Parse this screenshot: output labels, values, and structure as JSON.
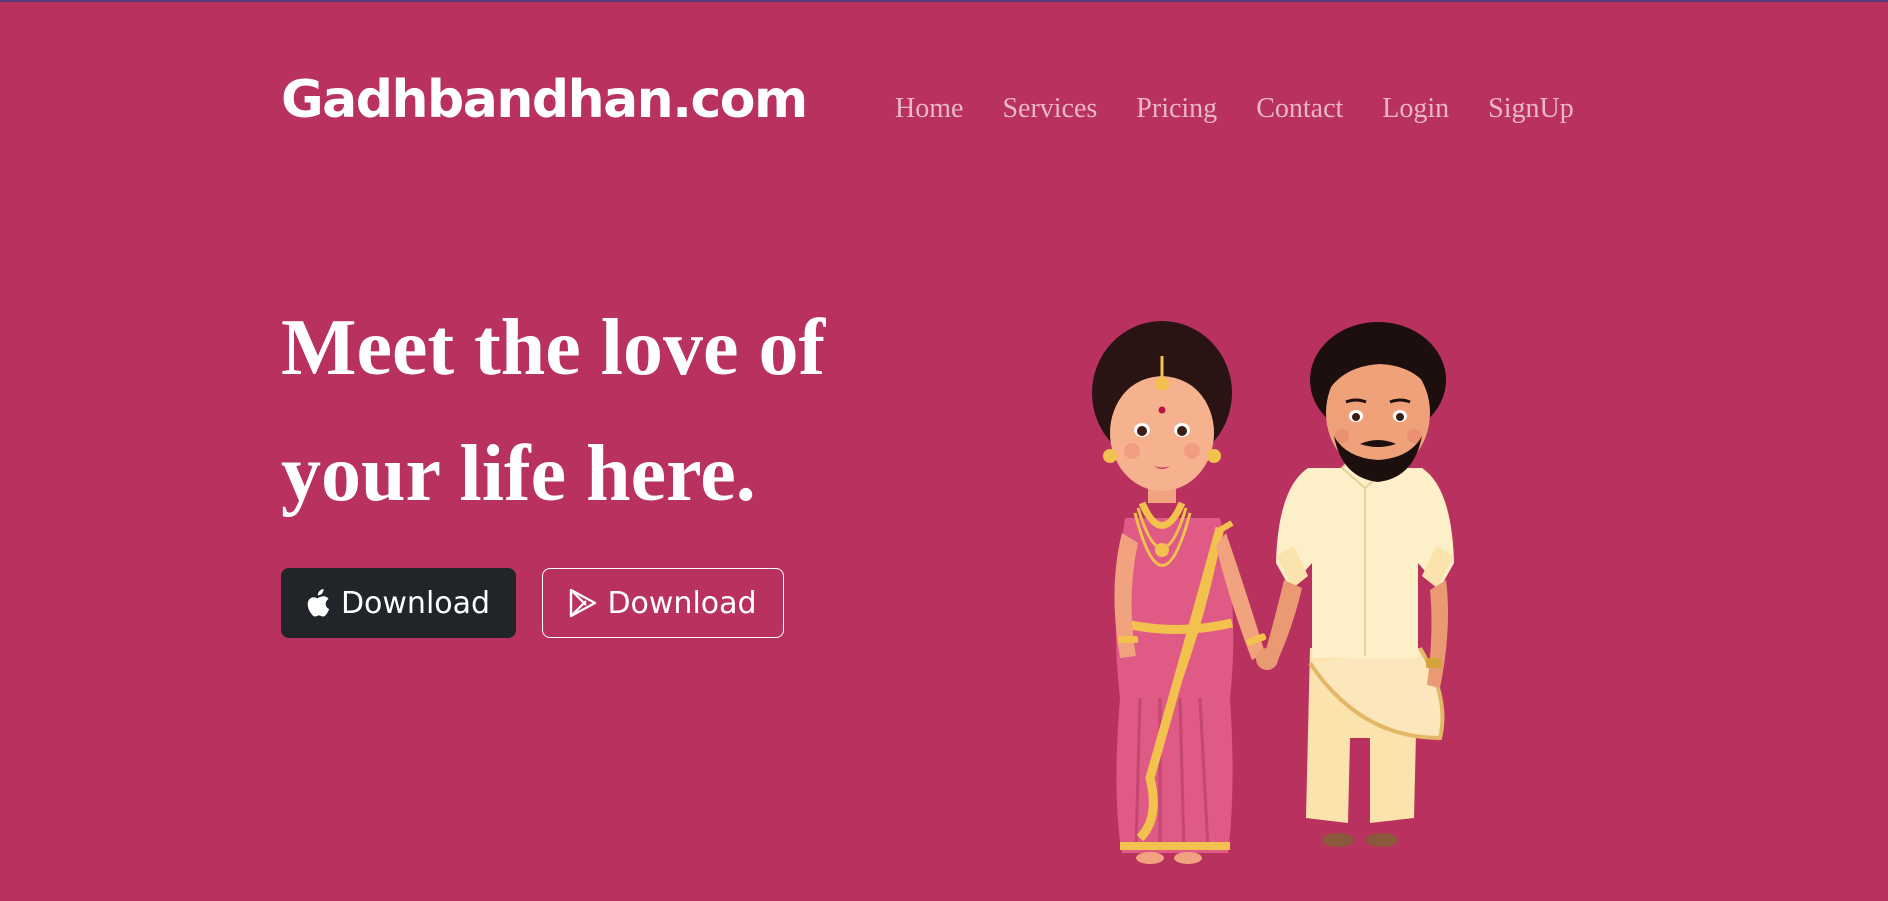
{
  "header": {
    "brand": "Gadhbandhan.com",
    "nav": [
      {
        "label": "Home"
      },
      {
        "label": "Services"
      },
      {
        "label": "Pricing"
      },
      {
        "label": "Contact"
      },
      {
        "label": "Login"
      },
      {
        "label": "SignUp"
      }
    ]
  },
  "hero": {
    "title": "Meet the love of your life here.",
    "buttons": [
      {
        "label": "Download",
        "icon": "apple-icon"
      },
      {
        "label": "Download",
        "icon": "google-play-icon"
      }
    ],
    "illustration": "bride-and-groom-illustration"
  },
  "colors": {
    "background": "#b9325f",
    "nav_text": "#eab6c8",
    "dark_button": "#212529",
    "text": "#ffffff"
  }
}
